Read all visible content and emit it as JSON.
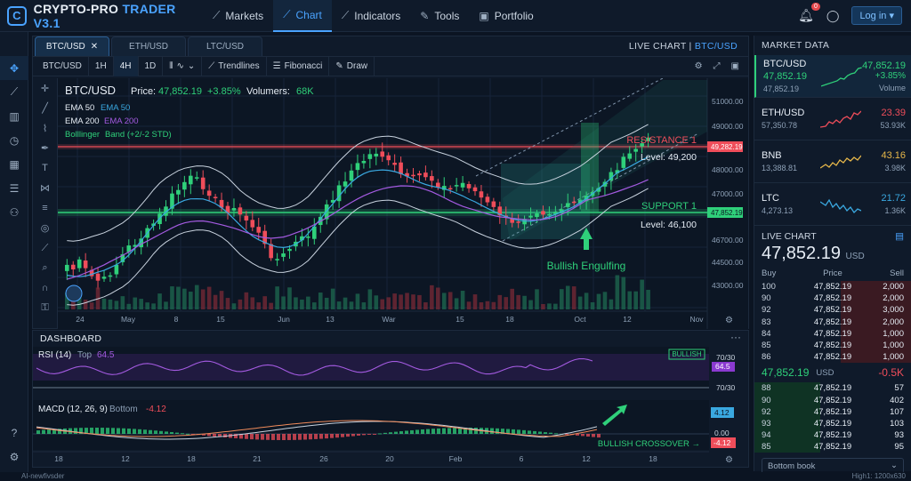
{
  "app": {
    "brand": "CRYPTO-PRO",
    "version": "TRADER V3.1",
    "login": "Log in ▾",
    "notif_count": "0"
  },
  "nav": [
    {
      "label": "Markets",
      "icon": "chart-line-icon"
    },
    {
      "label": "Chart",
      "icon": "chart-trend-icon",
      "active": true
    },
    {
      "label": "Indicators",
      "icon": "indicator-icon"
    },
    {
      "label": "Tools",
      "icon": "tools-icon"
    },
    {
      "label": "Portfolio",
      "icon": "briefcase-icon"
    }
  ],
  "chart_tabs": [
    "BTC/USD",
    "ETH/USD",
    "LTC/USD"
  ],
  "live_chart_label": "LIVE CHART",
  "live_chart_pair": "BTC/USD",
  "toolbar": {
    "symbol": "BTC/USD",
    "intervals": [
      "1H",
      "4H",
      "1D"
    ],
    "active_interval": "4H",
    "trendlines": "Trendlines",
    "fibonacci": "Fibonacci",
    "draw": "Draw"
  },
  "legend": {
    "pair": "BTC/USD",
    "price_label": "Price:",
    "price": "47,852.19",
    "change": "+3.85%",
    "volume_label": "Volumers:",
    "volume": "68K",
    "ema50_label": "EMA 50",
    "ema50_tag": "EMA 50",
    "ema200_label": "EMA 200",
    "ema200_tag": "EMA 200",
    "boll_label": "Bolllinger",
    "boll_tag": "Band (+2/-2 STD)"
  },
  "annotations": {
    "resistance": "RESISTANCE 1",
    "resistance_level": "Level: 49,200",
    "support": "SUPPORT 1",
    "support_level": "Level: 46,100",
    "pattern": "Bullish Engulfing",
    "resistance_tag": "49,282.19",
    "support_tag": "47,852.19"
  },
  "colors": {
    "up": "#2fd07a",
    "down": "#ef4d5a",
    "accent": "#4aa3ff",
    "ema50": "#3aa8e0",
    "ema200": "#a35ae0"
  },
  "chart_data": {
    "type": "candlestick",
    "y_ticks": [
      "51000.00",
      "49000.00",
      "48000.00",
      "47000.00",
      "46700.00",
      "44500.00",
      "43000.00"
    ],
    "x_ticks": [
      "24",
      "May",
      "8",
      "15",
      "Jun",
      "13",
      "War",
      "15",
      "18",
      "Oct",
      "12",
      "Nov"
    ],
    "resistance": 49200,
    "support": 46100
  },
  "dashboard": {
    "title": "DASHBOARD",
    "rsi": {
      "label": "RSI (14)",
      "pos": "Top",
      "value": "64.5",
      "badge": "BULLISH",
      "tag": "64.5",
      "level_high": "70/30",
      "level_low": "70/30"
    },
    "macd": {
      "label": "MACD (12, 26, 9)",
      "pos": "Bottom",
      "value": "-4.12",
      "tag_up": "4.12",
      "tag_zero": "0.00",
      "tag_down": "-4.12",
      "crossover": "BULLISH CROSSOVER →"
    },
    "x_ticks": [
      "18",
      "12",
      "18",
      "21",
      "26",
      "20",
      "Feb",
      "6",
      "12",
      "18"
    ]
  },
  "market_data": {
    "title": "MARKET DATA",
    "items": [
      {
        "sym": "BTC/USD",
        "sub": "47,852.19",
        "sub2": "47,852.19",
        "price": "47,852.19",
        "chg": "+3.85%",
        "vol": "Volume",
        "dir": "up"
      },
      {
        "sym": "ETH/USD",
        "sub": "57,350.78",
        "price": "23.39",
        "vol": "53.93K",
        "dir": "dn"
      },
      {
        "sym": "BNB",
        "sub": "13,388.81",
        "price": "43.16",
        "vol": "3.98K",
        "dir": "gold"
      },
      {
        "sym": "LTC",
        "sub": "4,273.13",
        "price": "21.72",
        "vol": "1.36K",
        "dir": "blue"
      }
    ]
  },
  "live": {
    "title": "LIVE CHART",
    "price": "47,852.19",
    "ccy": "USD",
    "cols": [
      "Buy",
      "Price",
      "Sell"
    ],
    "asks": [
      [
        "100",
        "47,852.19",
        "2,000"
      ],
      [
        "90",
        "47,852.19",
        "2,000"
      ],
      [
        "92",
        "47,852.19",
        "3,000"
      ],
      [
        "83",
        "47,852.19",
        "2,000"
      ],
      [
        "84",
        "47,852.19",
        "1,000"
      ],
      [
        "85",
        "47,852.19",
        "1,000"
      ],
      [
        "86",
        "47,852.19",
        "1,000"
      ]
    ],
    "mid_price": "47,852.19",
    "mid_ccy": "USD",
    "mid_change": "-0.5K",
    "bids": [
      [
        "88",
        "47,852.19",
        "57"
      ],
      [
        "90",
        "47,852.19",
        "402"
      ],
      [
        "92",
        "47,852.19",
        "107"
      ],
      [
        "93",
        "47,852.19",
        "103"
      ],
      [
        "94",
        "47,852.19",
        "93"
      ],
      [
        "85",
        "47,852.19",
        "95"
      ]
    ],
    "book": "Bottom book"
  },
  "status": {
    "left": "AI-newfivsder",
    "right": "High1: 1200x630"
  }
}
